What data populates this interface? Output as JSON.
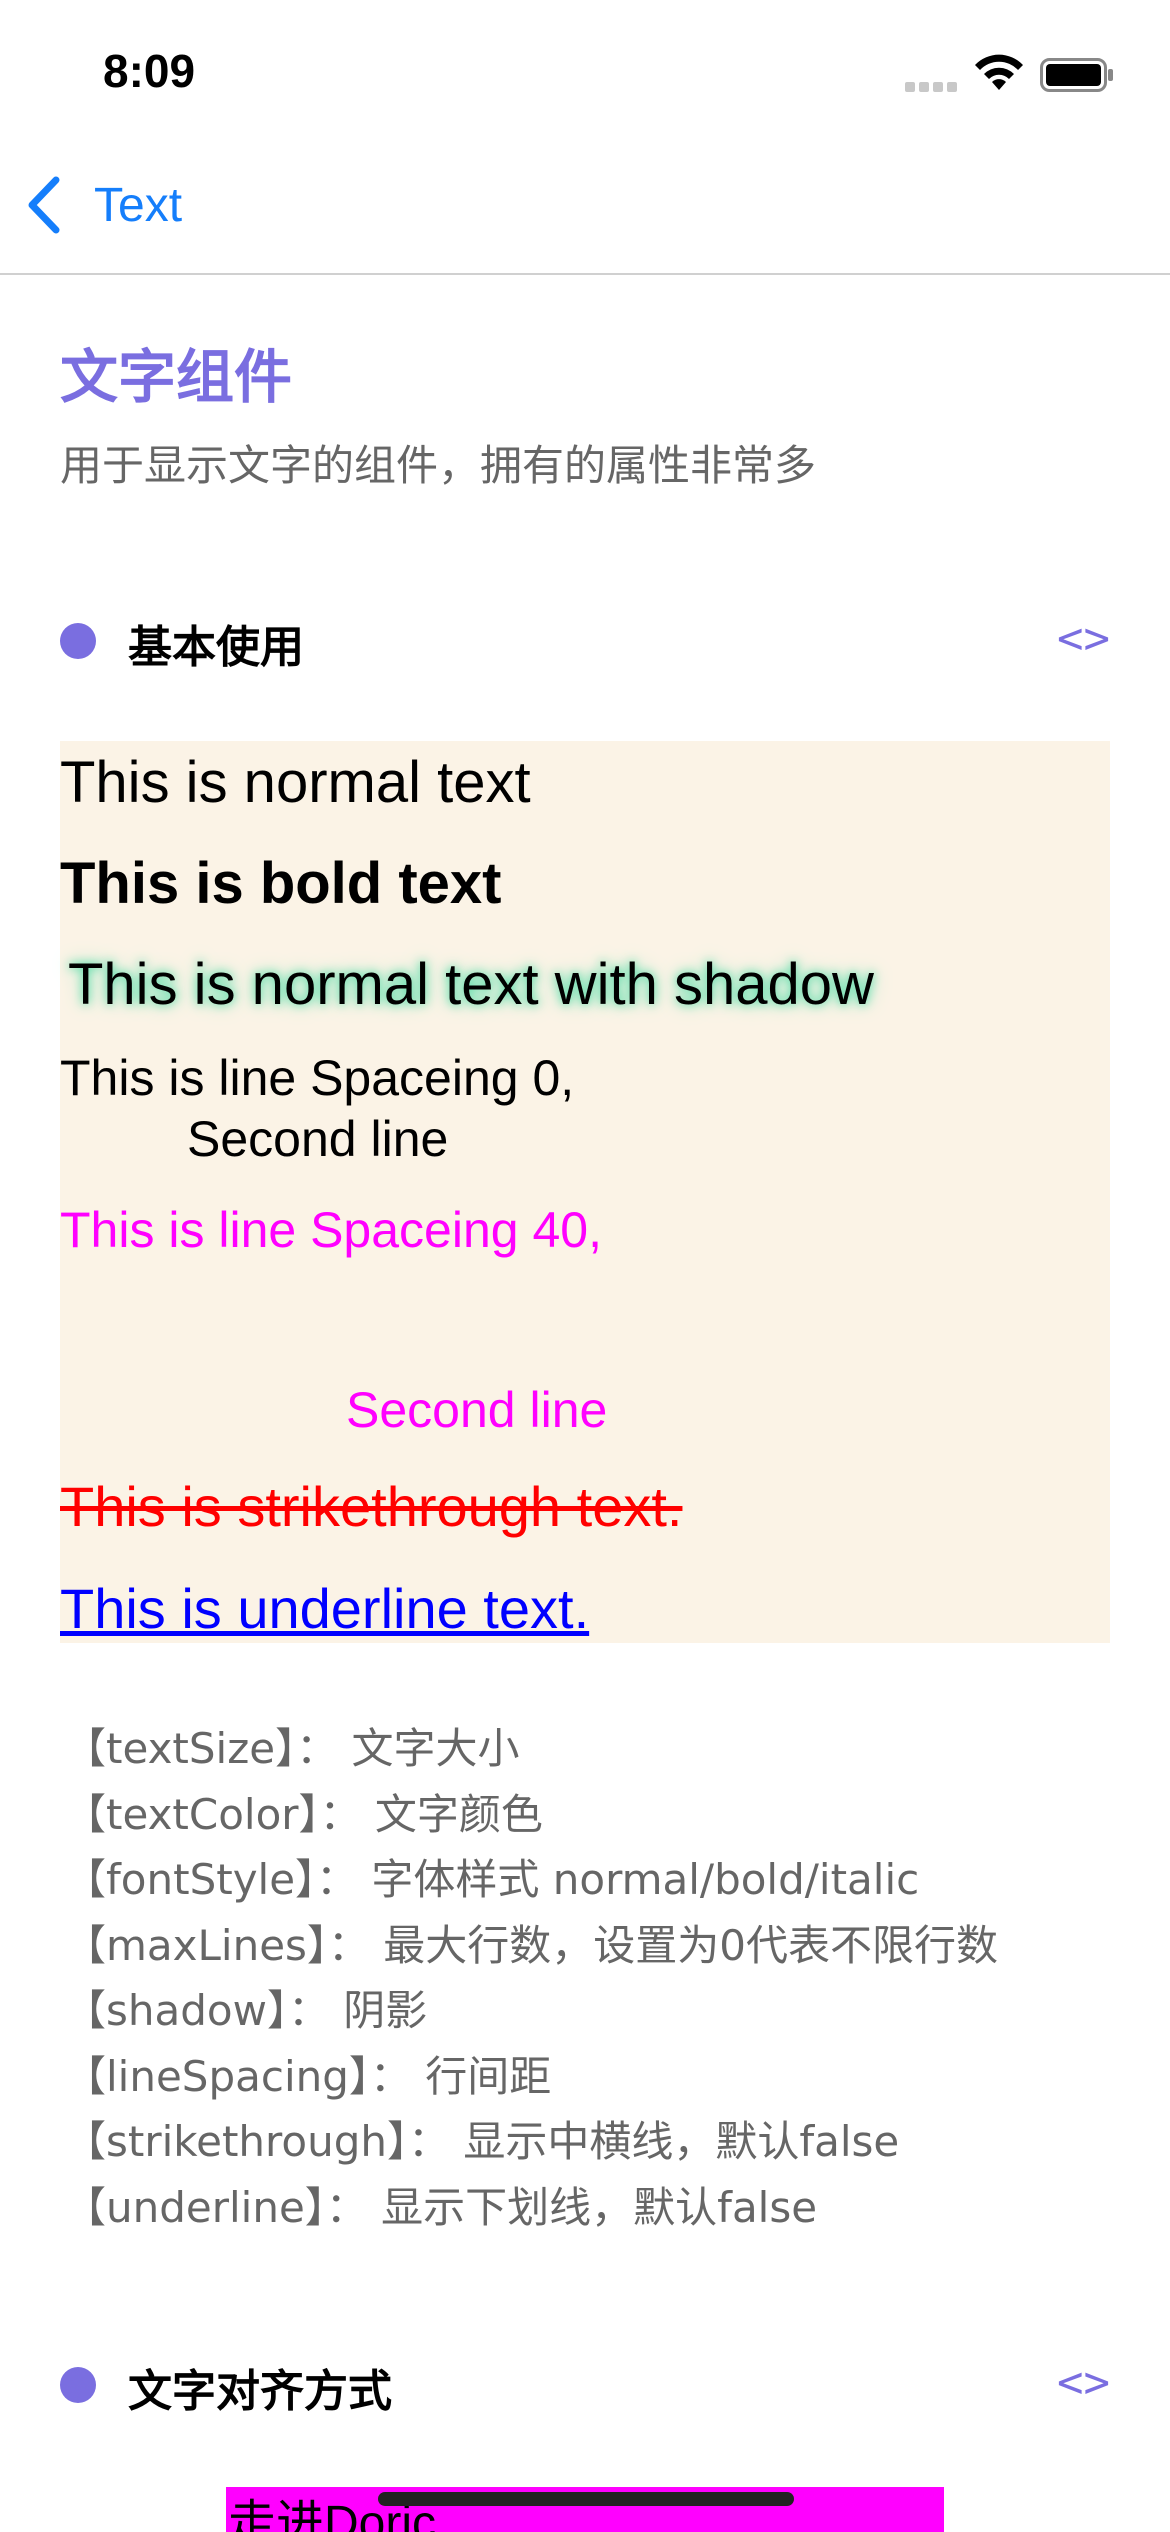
{
  "status_bar": {
    "time": "8:09"
  },
  "nav": {
    "back_label": "Text"
  },
  "header": {
    "title": "文字组件",
    "subtitle": "用于显示文字的组件，拥有的属性非常多"
  },
  "sections": [
    {
      "title": "基本使用",
      "code_toggle": "<>"
    },
    {
      "title": "文字对齐方式",
      "code_toggle": "<>"
    }
  ],
  "demo": {
    "normal": "This is normal text",
    "bold": "This is bold text",
    "shadow": "This is normal text with shadow",
    "spacing0_line1": "This is line Spaceing 0,",
    "spacing0_line2": "Second line",
    "spacing40_line1": "This is line Spaceing 40,",
    "spacing40_line2": "Second line",
    "strikethrough": "This is strikethrough text.",
    "underline": "This is underline text."
  },
  "properties": [
    "【textSize】： 文字大小",
    "【textColor】： 文字颜色",
    "【fontStyle】： 字体样式 normal/bold/italic",
    "【maxLines】： 最大行数，设置为0代表不限行数",
    "【shadow】： 阴影",
    "【lineSpacing】： 行间距",
    "【strikethrough】： 显示中横线，默认false",
    "【underline】： 显示下划线，默认false"
  ],
  "align_demo": {
    "text": "走进Doric"
  },
  "colors": {
    "accent": "#7a6ee0",
    "link_blue": "#157efb",
    "demo_bg": "#fbf3e6",
    "magenta": "#ff00ff",
    "strike_red": "#ff0000",
    "underline_blue": "#0000ff"
  }
}
